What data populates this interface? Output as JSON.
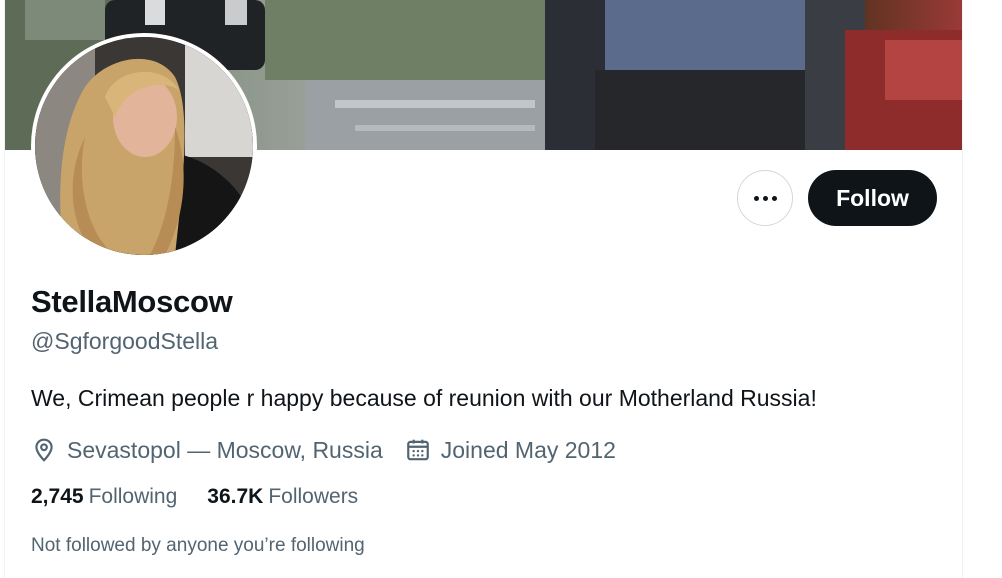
{
  "profile": {
    "display_name": "StellaMoscow",
    "handle": "@SgforgoodStella",
    "bio": "We, Crimean people r happy because of reunion with our Motherland Russia!",
    "location": "Sevastopol — Moscow, Russia",
    "joined": "Joined May 2012"
  },
  "stats": {
    "following_count": "2,745",
    "following_label": "Following",
    "followers_count": "36.7K",
    "followers_label": "Followers"
  },
  "social_context": "Not followed by anyone you’re following",
  "actions": {
    "follow_label": "Follow",
    "more_icon": "more-horizontal-icon"
  },
  "icons": {
    "location": "location-pin-icon",
    "calendar": "calendar-icon"
  },
  "colors": {
    "primary_text": "#0f1419",
    "secondary_text": "#536471",
    "follow_button_bg": "#0f1419",
    "border": "#cfd9de"
  }
}
